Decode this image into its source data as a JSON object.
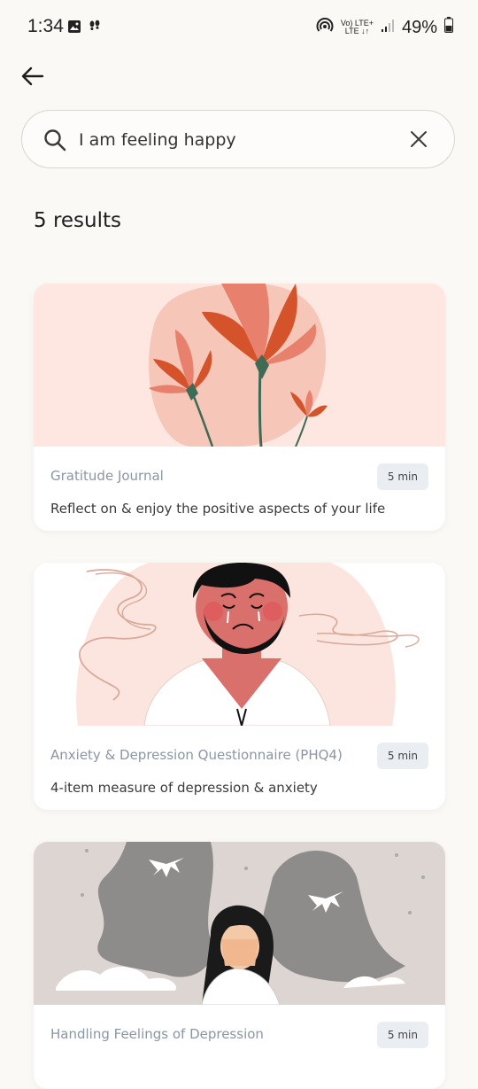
{
  "status_bar": {
    "time": "1:34",
    "network_top": "Vo) LTE+",
    "network_bottom": "LTE ↓↑",
    "battery": "49%"
  },
  "search": {
    "value": "I am feeling happy",
    "placeholder": "Search"
  },
  "results": {
    "count_label": "5 results"
  },
  "cards": [
    {
      "title": "Gratitude Journal",
      "duration": "5 min",
      "description": "Reflect on & enjoy the positive aspects of your life"
    },
    {
      "title": "Anxiety & Depression Questionnaire (PHQ4)",
      "duration": "5 min",
      "description": "4-item measure of depression & anxiety"
    },
    {
      "title": "Handling Feelings of Depression",
      "duration": "5 min",
      "description": ""
    }
  ],
  "colors": {
    "background": "#fbf9f5",
    "card_title": "#8a96a4",
    "badge_bg": "#eaedf2",
    "flower_orange": "#d4532a",
    "flower_pink": "#e8806e",
    "blush_bg": "#fbe5de"
  }
}
